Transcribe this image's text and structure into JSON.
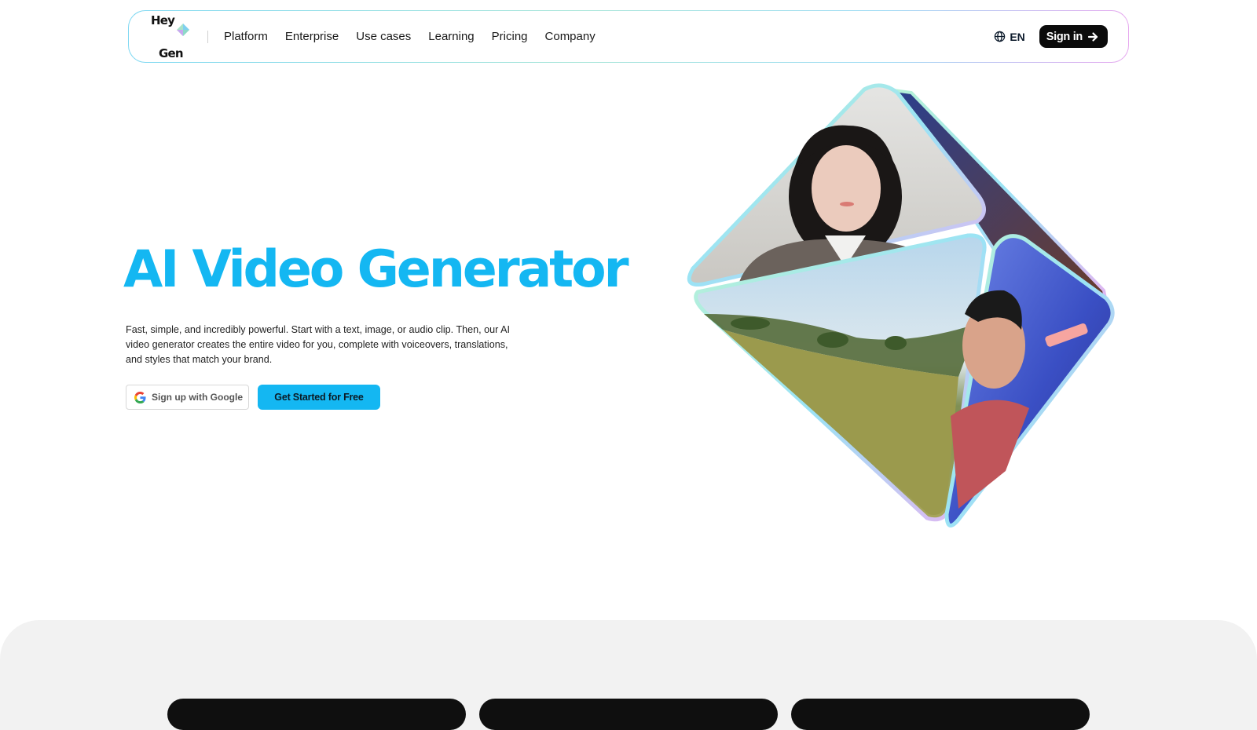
{
  "brand": {
    "logo_line1": "Hey",
    "logo_line2": "Gen",
    "accent_color": "#14b7f2"
  },
  "nav": {
    "links": [
      "Platform",
      "Enterprise",
      "Use cases",
      "Learning",
      "Pricing",
      "Company"
    ],
    "language_icon": "globe-icon",
    "language": "EN",
    "signin_label": "Sign in",
    "signin_icon": "arrow-right-icon"
  },
  "hero": {
    "title": "AI Video Generator",
    "description": "Fast, simple, and incredibly powerful. Start with a text, image, or audio clip. Then, our AI video generator creates the entire video for you, complete with voiceovers, translations, and styles that match your brand.",
    "google_button_label": "Sign up with Google",
    "google_icon": "google-icon",
    "cta_label": "Get Started for Free",
    "visual": {
      "type": "octahedron-video-collage",
      "faces": [
        "woman-avatar-video",
        "landscape-meadow-video",
        "man-avatar-video"
      ]
    }
  },
  "colors": {
    "title": "#14b7f2",
    "cta_bg": "#14b7f2",
    "signin_bg": "#0b0b0b",
    "bottom_section_bg": "#f2f2f2"
  }
}
